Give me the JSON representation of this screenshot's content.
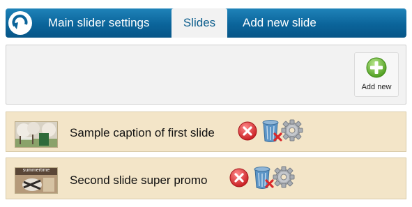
{
  "nav": {
    "tabs": [
      {
        "label": "Main slider settings",
        "active": false
      },
      {
        "label": "Slides",
        "active": true
      },
      {
        "label": "Add new slide",
        "active": false
      }
    ]
  },
  "panel": {
    "add_new_label": "Add new"
  },
  "slides": [
    {
      "caption": "Sample caption of first slide",
      "thumb_icon": "photo-thumbnail"
    },
    {
      "caption": "Second slide super promo",
      "thumb_icon": "photo-thumbnail",
      "thumb_text": "summertime"
    }
  ],
  "colors": {
    "nav_top": "#1f83b9",
    "nav_bottom": "#075688",
    "active_tab_bg": "#f2f2f2",
    "active_tab_text": "#0b5d8c",
    "row_bg": "#f3e5c8",
    "delete_red": "#d9292b",
    "add_green": "#63b22e"
  }
}
